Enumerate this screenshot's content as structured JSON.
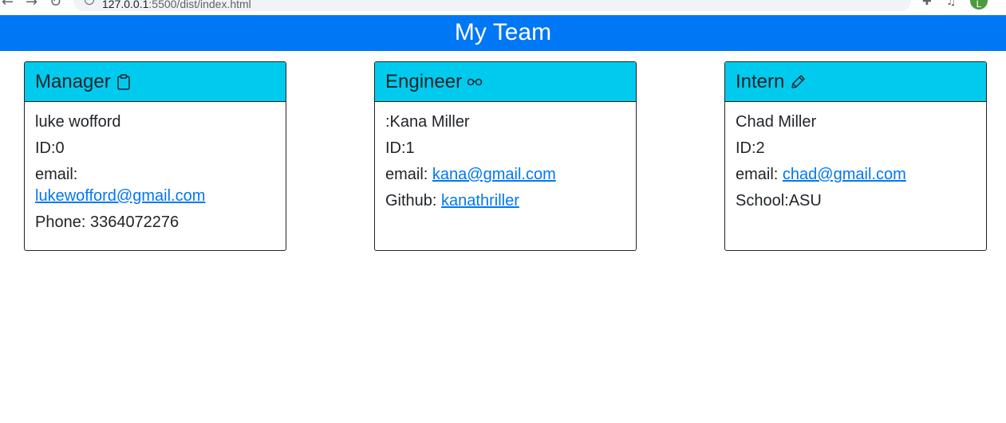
{
  "browser": {
    "url_host": "127.0.0.1",
    "url_path": ":5500/dist/index.html",
    "avatar_letter": "L"
  },
  "header": {
    "title": "My Team"
  },
  "cards": [
    {
      "role": "Manager",
      "icon": "clipboard-icon",
      "name": "luke wofford",
      "id": "ID:0",
      "email_label": "email:",
      "email": "lukewofford@gmail.com",
      "extra": "Phone: 3364072276"
    },
    {
      "role": "Engineer",
      "icon": "glasses-icon",
      "name": ":Kana Miller",
      "id": "ID:1",
      "email_label": "email:",
      "email": "kana@gmail.com",
      "extra_label": "Github:",
      "extra_link": "kanathriller"
    },
    {
      "role": "Intern",
      "icon": "pencil-icon",
      "name": "Chad Miller",
      "id": "ID:2",
      "email_label": "email:",
      "email": "chad@gmail.com",
      "extra": "School:ASU"
    }
  ],
  "colors": {
    "header": "#0077f5",
    "card_header": "#00caee",
    "link": "#0077f5"
  }
}
